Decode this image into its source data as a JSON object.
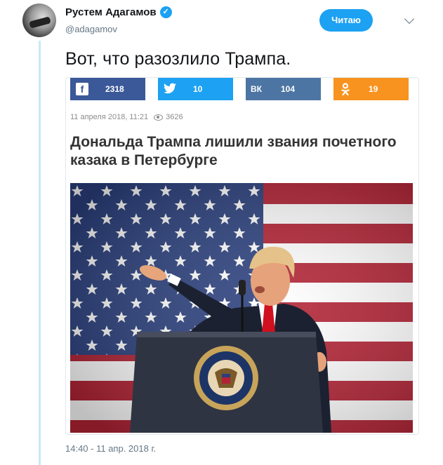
{
  "author": {
    "name": "Рустем Адагамов",
    "handle": "@adagamov",
    "verified_icon": "verified-badge-icon"
  },
  "follow_button": {
    "label": "Читаю"
  },
  "tweet": {
    "text": "Вот, что разозлило Трампа.",
    "timestamp": "14:40 - 11 апр. 2018 г."
  },
  "card": {
    "share": [
      {
        "network": "facebook",
        "icon": "f",
        "count": "2318",
        "color": "#3b5998"
      },
      {
        "network": "twitter",
        "icon": "twitter-bird",
        "count": "10",
        "color": "#1da1f2"
      },
      {
        "network": "vk",
        "icon": "vk",
        "count": "104",
        "color": "#4c75a3"
      },
      {
        "network": "odnoklassniki",
        "icon": "ok",
        "count": "19",
        "color": "#f7931e"
      }
    ],
    "date": "11 апреля 2018, 11:21",
    "views": "3626",
    "headline": "Дональда Трампа лишили звания почетного казака в Петербурге",
    "seal_text": "SEAL OF THE PRESIDENT OF THE UNITED STATES"
  },
  "colors": {
    "accent": "#1da1f2",
    "thread": "#c6ebf9"
  }
}
